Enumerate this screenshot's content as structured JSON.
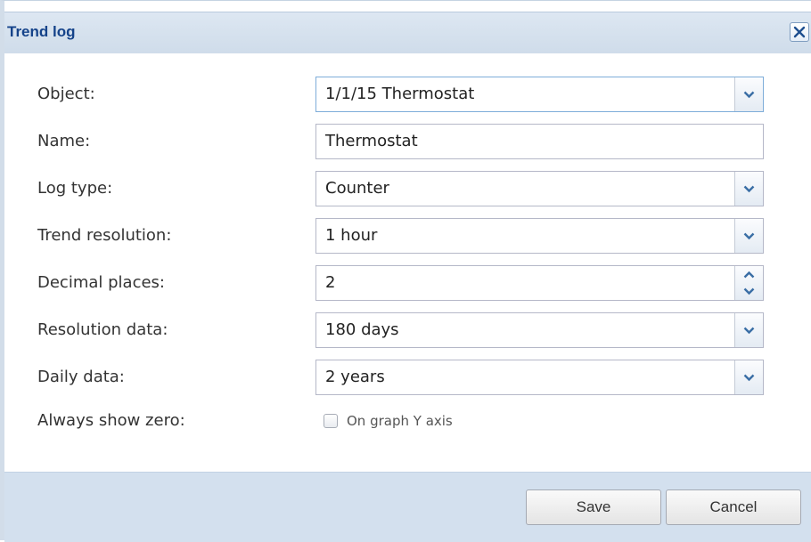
{
  "dialog": {
    "title": "Trend log",
    "close_icon": "close-x-icon",
    "accent_color": "#15438a"
  },
  "form": {
    "object": {
      "label": "Object:",
      "value": "1/1/15 Thermostat",
      "icon": "chevron-down-icon"
    },
    "name": {
      "label": "Name:",
      "value": "Thermostat"
    },
    "log_type": {
      "label": "Log type:",
      "value": "Counter",
      "icon": "chevron-down-icon"
    },
    "trend_resolution": {
      "label": "Trend resolution:",
      "value": "1 hour",
      "icon": "chevron-down-icon"
    },
    "decimal_places": {
      "label": "Decimal places:",
      "value": "2",
      "icon_up": "spinner-up-icon",
      "icon_down": "spinner-down-icon"
    },
    "resolution_data": {
      "label": "Resolution data:",
      "value": "180 days",
      "icon": "chevron-down-icon"
    },
    "daily_data": {
      "label": "Daily data:",
      "value": "2 years",
      "icon": "chevron-down-icon"
    },
    "always_show_zero": {
      "label": "Always show zero:",
      "checkbox_label": "On graph Y axis",
      "checked": false
    }
  },
  "footer": {
    "save_label": "Save",
    "cancel_label": "Cancel"
  }
}
